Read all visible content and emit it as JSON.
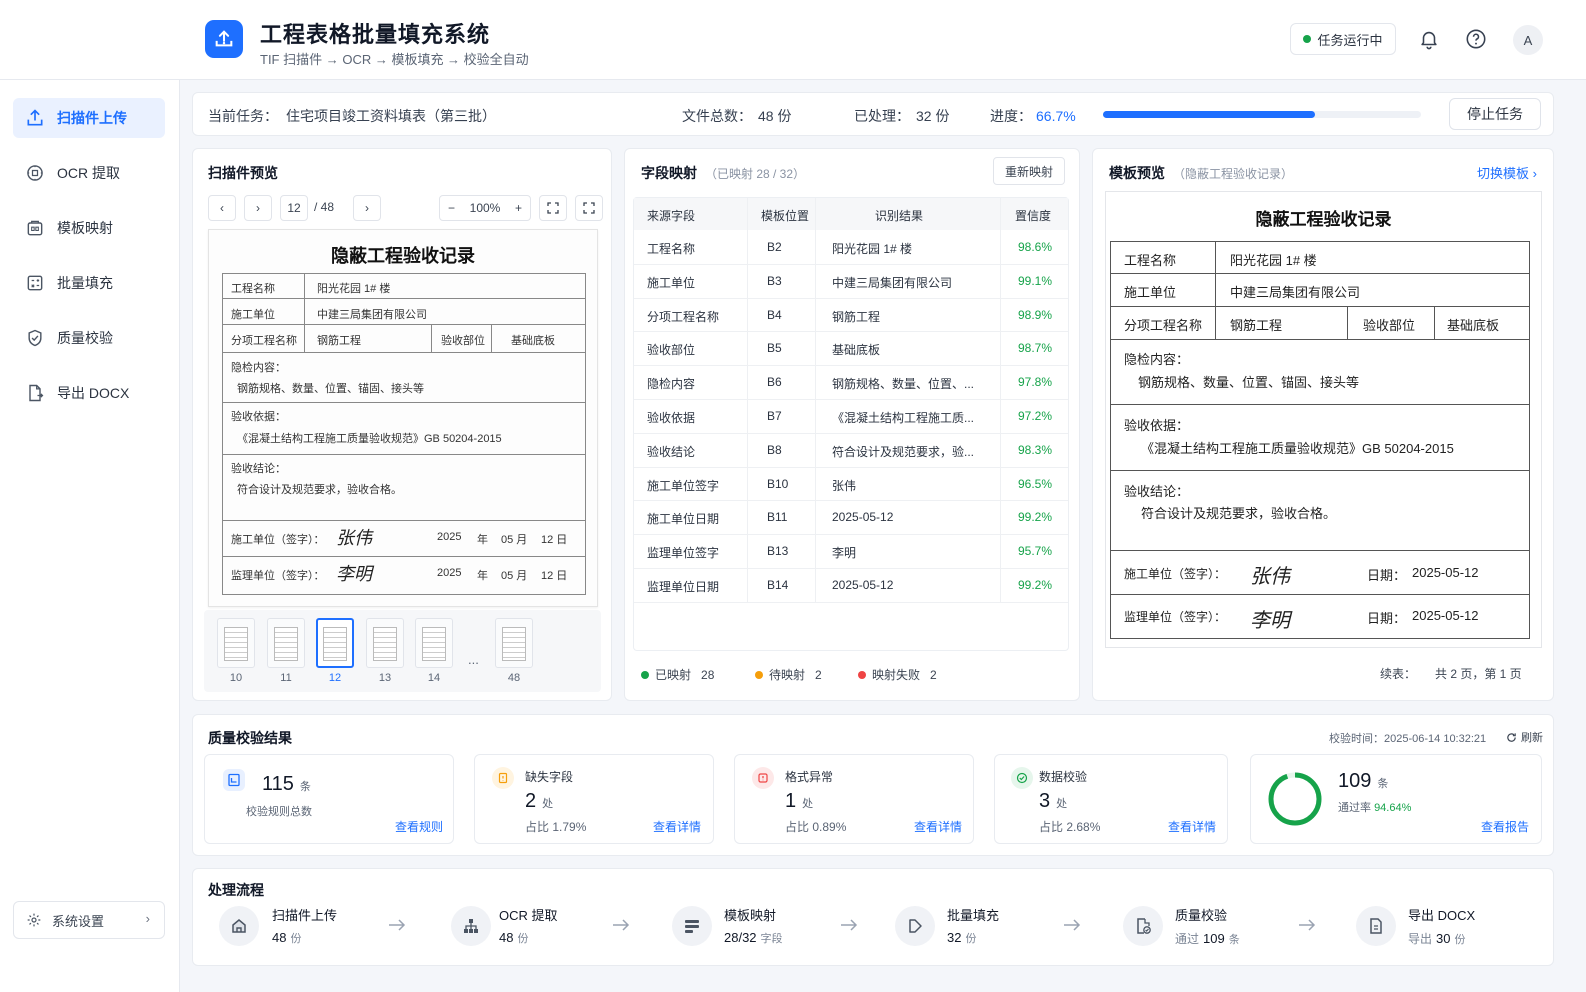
{
  "app": {
    "title": "工程表格批量填充系统",
    "subtitle": "TIF 扫描件 → OCR → 模板填充 → 校验全自动",
    "status": "任务运行中",
    "avatar": "A"
  },
  "colors": {
    "accent": "#1e6fff",
    "success": "#16a34a",
    "warning": "#f59e0b",
    "error": "#ef4444"
  },
  "sidebar": {
    "items": [
      {
        "label": "扫描件上传",
        "icon": "upload-icon",
        "active": true
      },
      {
        "label": "OCR 提取",
        "icon": "ocr-icon"
      },
      {
        "label": "模板映射",
        "icon": "template-map-icon"
      },
      {
        "label": "批量填充",
        "icon": "batch-fill-icon"
      },
      {
        "label": "质量校验",
        "icon": "shield-check-icon"
      },
      {
        "label": "导出 DOCX",
        "icon": "export-icon"
      }
    ],
    "settings": "系统设置"
  },
  "task": {
    "current_label": "当前任务：",
    "current_value": "住宅项目竣工资料填表（第三批）",
    "total_label": "文件总数：",
    "total_value": "48 份",
    "processed_label": "已处理：",
    "processed_value": "32 份",
    "progress_label": "进度：",
    "progress_value": "66.7%",
    "progress_fraction": 0.667,
    "stop": "停止任务"
  },
  "preview": {
    "title": "扫描件预览",
    "page_current": "12",
    "page_total": "/ 48",
    "zoom": "100%",
    "doc": {
      "title": "隐蔽工程验收记录",
      "row1_label": "工程名称",
      "row1_value": "阳光花园 1# 楼",
      "row2_label": "施工单位",
      "row2_value": "中建三局集团有限公司",
      "row3_label": "分项工程名称",
      "row3_value": "钢筋工程",
      "row3_label2": "验收部位",
      "row3_value2": "基础底板",
      "content_label": "隐检内容：",
      "content_value": "钢筋规格、数量、位置、锚固、接头等",
      "basis_label": "验收依据：",
      "basis_value": "《混凝土结构工程施工质量验收规范》GB 50204-2015",
      "conclusion_label": "验收结论：",
      "conclusion_value": "符合设计及规范要求，验收合格。",
      "sign1_label": "施工单位（签字）：",
      "sign1_name": "张伟",
      "sign2_label": "监理单位（签字）：",
      "sign2_name": "李明",
      "year": "2025",
      "year_unit": "年",
      "month": "05 月",
      "day": "12 日"
    },
    "thumbs": [
      "10",
      "11",
      "12",
      "13",
      "14",
      "48"
    ],
    "ellipsis": "..."
  },
  "mapping": {
    "title": "字段映射",
    "subtitle": "（已映射 28 / 32）",
    "remap": "重新映射",
    "headers": [
      "来源字段",
      "模板位置",
      "识别结果",
      "置信度"
    ],
    "rows": [
      {
        "field": "工程名称",
        "pos": "B2",
        "result": "阳光花园 1# 楼",
        "conf": "98.6%"
      },
      {
        "field": "施工单位",
        "pos": "B3",
        "result": "中建三局集团有限公司",
        "conf": "99.1%"
      },
      {
        "field": "分项工程名称",
        "pos": "B4",
        "result": "钢筋工程",
        "conf": "98.9%"
      },
      {
        "field": "验收部位",
        "pos": "B5",
        "result": "基础底板",
        "conf": "98.7%"
      },
      {
        "field": "隐检内容",
        "pos": "B6",
        "result": "钢筋规格、数量、位置、...",
        "conf": "97.8%"
      },
      {
        "field": "验收依据",
        "pos": "B7",
        "result": "《混凝土结构工程施工质...",
        "conf": "97.2%"
      },
      {
        "field": "验收结论",
        "pos": "B8",
        "result": "符合设计及规范要求，验...",
        "conf": "98.3%"
      },
      {
        "field": "施工单位签字",
        "pos": "B10",
        "result": "张伟",
        "conf": "96.5%"
      },
      {
        "field": "施工单位日期",
        "pos": "B11",
        "result": "2025-05-12",
        "conf": "99.2%"
      },
      {
        "field": "监理单位签字",
        "pos": "B13",
        "result": "李明",
        "conf": "95.7%"
      },
      {
        "field": "监理单位日期",
        "pos": "B14",
        "result": "2025-05-12",
        "conf": "99.2%"
      }
    ],
    "legend": [
      {
        "label": "已映射",
        "count": "28",
        "color": "#16a34a"
      },
      {
        "label": "待映射",
        "count": "2",
        "color": "#f59e0b"
      },
      {
        "label": "映射失败",
        "count": "2",
        "color": "#ef4444"
      }
    ]
  },
  "template": {
    "title": "模板预览",
    "subtitle": "（隐蔽工程验收记录）",
    "switch": "切换模板",
    "doc_title": "隐蔽工程验收记录",
    "row1_label": "工程名称",
    "row1_value": "阳光花园 1# 楼",
    "row2_label": "施工单位",
    "row2_value": "中建三局集团有限公司",
    "row3_label": "分项工程名称",
    "row3_value": "钢筋工程",
    "row3_label2": "验收部位",
    "row3_value2": "基础底板",
    "content_label": "隐检内容：",
    "content_value": "钢筋规格、数量、位置、锚固、接头等",
    "basis_label": "验收依据：",
    "basis_value": "《混凝土结构工程施工质量验收规范》GB 50204-2015",
    "conclusion_label": "验收结论：",
    "conclusion_value": "符合设计及规范要求，验收合格。",
    "sign1_label": "施工单位（签字）：",
    "sign1_name": "张伟",
    "sign2_label": "监理单位（签字）：",
    "sign2_name": "李明",
    "date_label": "日期：",
    "date_value": "2025-05-12",
    "footer_label": "续表：",
    "footer_pages": "共 2 页，第 1 页"
  },
  "qc": {
    "title": "质量校验结果",
    "time": "校验时间：2025-06-14 10:32:21",
    "refresh": "刷新",
    "rules": {
      "value": "115",
      "unit": "条",
      "label": "校验规则总数",
      "link": "查看规则"
    },
    "missing": {
      "label": "缺失字段",
      "value": "2",
      "unit": "处",
      "ratio": "占比 1.79%",
      "link": "查看详情"
    },
    "format": {
      "label": "格式异常",
      "value": "1",
      "unit": "处",
      "ratio": "占比 0.89%",
      "link": "查看详情"
    },
    "data": {
      "label": "数据校验",
      "value": "3",
      "unit": "处",
      "ratio": "占比 2.68%",
      "link": "查看详情"
    },
    "pass": {
      "value": "109",
      "unit": "条",
      "label": "通过率",
      "rate": "94.64%",
      "fraction": 0.9464,
      "link": "查看报告"
    }
  },
  "flow": {
    "title": "处理流程",
    "steps": [
      {
        "name": "扫描件上传",
        "value": "48",
        "unit": "份",
        "icon": "home-icon"
      },
      {
        "name": "OCR 提取",
        "value": "48",
        "unit": "份",
        "icon": "network-icon"
      },
      {
        "name": "模板映射",
        "value": "28/32",
        "unit": "字段",
        "icon": "layers-icon"
      },
      {
        "name": "批量填充",
        "value": "32",
        "unit": "份",
        "icon": "play-icon"
      },
      {
        "name": "质量校验",
        "prefix": "通过",
        "value": "109",
        "unit": "条",
        "icon": "file-check-icon"
      },
      {
        "name": "导出 DOCX",
        "prefix": "导出",
        "value": "30",
        "unit": "份",
        "icon": "doc-icon"
      }
    ]
  }
}
